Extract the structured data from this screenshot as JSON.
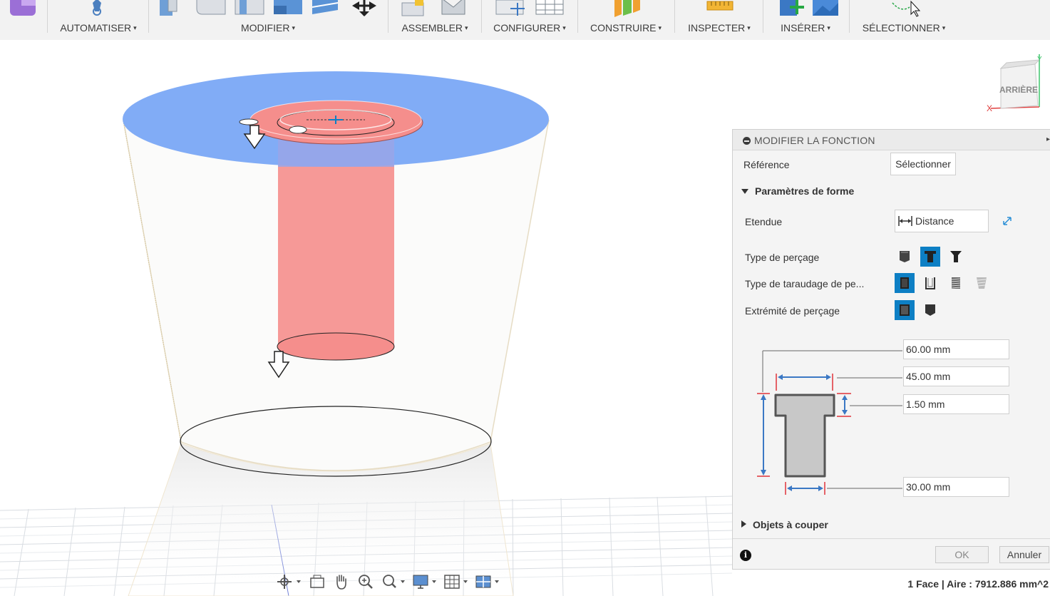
{
  "toolbar": {
    "groups": [
      {
        "label": "AUTOMATISER"
      },
      {
        "label": "MODIFIER"
      },
      {
        "label": "ASSEMBLER"
      },
      {
        "label": "CONFIGURER"
      },
      {
        "label": "CONSTRUIRE"
      },
      {
        "label": "INSPECTER"
      },
      {
        "label": "INSÉRER"
      },
      {
        "label": "SÉLECTIONNER"
      }
    ],
    "caret": "▾"
  },
  "viewcube": {
    "face_label": "ARRIÈRE",
    "axis_x": "X",
    "axis_y": "Y"
  },
  "panel": {
    "title": "MODIFIER LA FONCTION",
    "reference": {
      "label": "Référence",
      "button": "Sélectionner"
    },
    "shape_section": "Paramètres de forme",
    "extent": {
      "label": "Etendue",
      "value": "Distance"
    },
    "drill_type": {
      "label": "Type de perçage",
      "selected_index": 1
    },
    "tap_type": {
      "label": "Type de taraudage de pe...",
      "selected_index": 0
    },
    "drill_tip": {
      "label": "Extrémité de perçage",
      "selected_index": 0
    },
    "dimensions": {
      "depth": "60.00 mm",
      "cbore_diameter": "45.00 mm",
      "cbore_depth": "1.50 mm",
      "hole_diameter": "30.00 mm"
    },
    "objects_section": "Objets à couper",
    "ok": "OK",
    "cancel": "Annuler",
    "info": "i"
  },
  "status_bar": {
    "selection": "1 Face | Aire : 7912.886 mm^2"
  },
  "colors": {
    "accent": "#0d7fc4",
    "face_blue": "#7aa8f5",
    "hole_red": "#f58e8c",
    "dimension_blue": "#3b78c4",
    "dimension_red": "#e0333a"
  }
}
